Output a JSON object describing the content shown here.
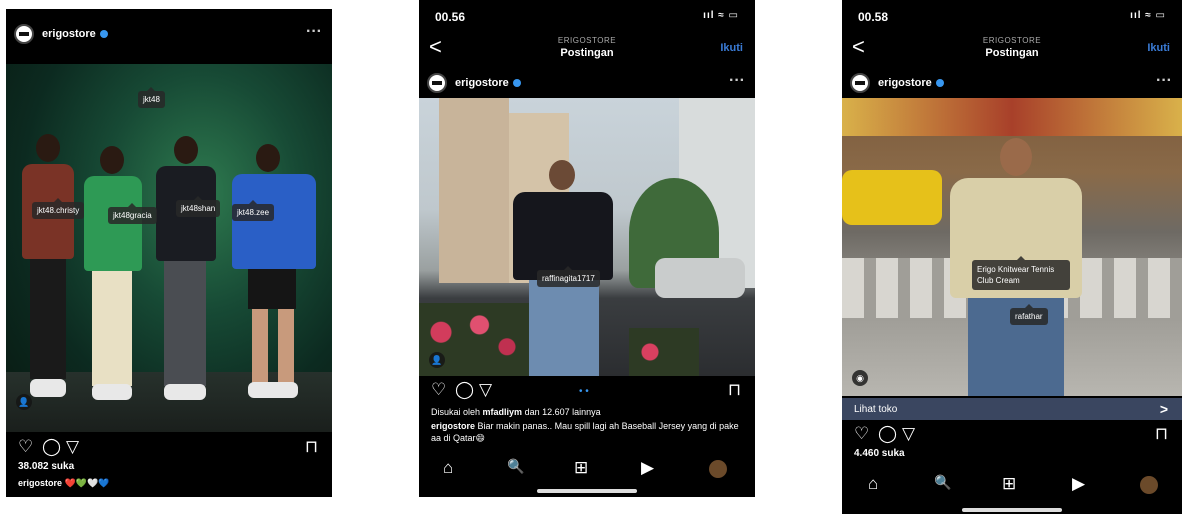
{
  "screen1": {
    "username": "erigostore",
    "more": "···",
    "tags": [
      "jkt48",
      "jkt48.christy",
      "jkt48gracia",
      "jkt48shan",
      "jkt48.zee"
    ],
    "likes": "38.082 suka",
    "caption_user": "erigostore",
    "caption_emoji": "❤️💚🤍💙"
  },
  "screen2": {
    "time": "00.56",
    "signal": "ııl ≈ ▭",
    "back": "<",
    "store_label": "ERIGOSTORE",
    "title": "Postingan",
    "follow": "Ikuti",
    "username": "erigostore",
    "more": "···",
    "tags": [
      "raffinagita1717"
    ],
    "liked_by_prefix": "Disukai oleh",
    "liked_by_user": "mfadliym",
    "liked_by_suffix": "dan 12.607 lainnya",
    "caption_user": "erigostore",
    "caption_text": "Biar makin panas.. Mau spill lagi ah Baseball Jersey yang di pake aa di Qatar😄"
  },
  "screen3": {
    "time": "00.58",
    "signal": "ııl ≈ ▭",
    "back": "<",
    "store_label": "ERIGOSTORE",
    "title": "Postingan",
    "follow": "Ikuti",
    "username": "erigostore",
    "more": "···",
    "product_tag": "Erigo Knitwear Tennis Club Cream",
    "tags": [
      "rafathar"
    ],
    "shop_label": "Lihat toko",
    "shop_arrow": ">",
    "likes": "4.460 suka"
  },
  "icons": {
    "heart": "♡",
    "comment": "◯",
    "share": "▽",
    "save": "⊓",
    "home": "⌂",
    "search": "🔍",
    "add": "⊞",
    "reels": "▶"
  },
  "colors": {
    "accent": "#3897f0",
    "follow": "#3a7bd5",
    "background": "#000000"
  }
}
